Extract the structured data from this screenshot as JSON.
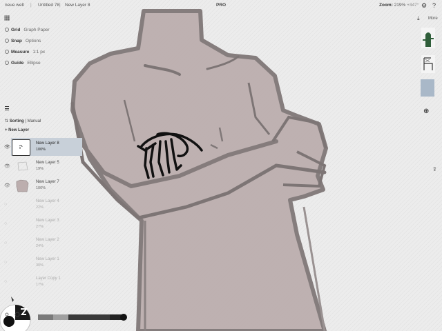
{
  "header": {
    "breadcrumbs": [
      "neue welt",
      "Untitled 78",
      "New Layer 8"
    ],
    "center_label": "PRO",
    "zoom_label": "Zoom:",
    "zoom_value": "219%",
    "rotation_value": "+347°",
    "icons": [
      "gear-icon",
      "help-icon"
    ]
  },
  "tools": [
    {
      "label": "Grid",
      "value": "Graph Paper"
    },
    {
      "label": "Snap",
      "value": "Options"
    },
    {
      "label": "Measure",
      "value": "1:1 px"
    },
    {
      "label": "Guide",
      "value": "Ellipse"
    }
  ],
  "layers_panel": {
    "sorting_label": "Sorting",
    "sorting_value": "Manual",
    "new_layer_label": "+ New Layer",
    "layers": [
      {
        "name": "New Layer 8",
        "opacity": "100%"
      },
      {
        "name": "New Layer 5",
        "opacity": "19%"
      },
      {
        "name": "New Layer 7",
        "opacity": "100%"
      },
      {
        "name": "New Layer 4",
        "opacity": "22%"
      },
      {
        "name": "New Layer 3",
        "opacity": "27%"
      },
      {
        "name": "New Layer 2",
        "opacity": "24%"
      },
      {
        "name": "New Layer 1",
        "opacity": "30%"
      },
      {
        "name": "Layer Copy 1",
        "opacity": "17%"
      }
    ]
  },
  "right_panel": {
    "more_label": "More",
    "swatch_color": "#a9b8c8",
    "icons": [
      "download-icon",
      "plus-icon",
      "share-icon"
    ]
  },
  "colors": {
    "background": "#ebebeb",
    "figure_fill": "#bcaeae",
    "figure_stroke": "#807878",
    "active_layer": "#c8d0d9"
  }
}
